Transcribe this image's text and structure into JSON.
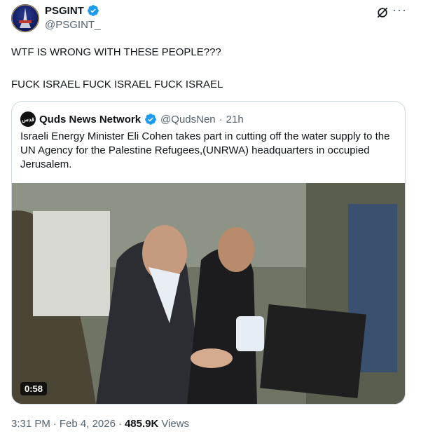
{
  "post": {
    "display_name": "PSGINT",
    "handle": "@PSGINT_",
    "avatar_text": "PSGINT",
    "line1": "WTF IS WRONG WITH THESE PEOPLE???",
    "line2": "FUCK ISRAEL FUCK ISRAEL FUCK ISRAEL",
    "time": "3:31 PM",
    "separator": "·",
    "date": "Feb 4, 2026",
    "views_count": "485.9K",
    "views_label": "Views"
  },
  "quote": {
    "display_name": "Quds News Network",
    "handle": "@QudsNen",
    "separator": "·",
    "time": "21h",
    "text": "Israeli Energy Minister Eli Cohen takes part in cutting off the water supply to the UN Agency for the Palestine Refugees,(UNRWA) headquarters in occupied Jerusalem.",
    "video_duration": "0:58"
  },
  "icons": {
    "verified": "verified-badge-icon",
    "grok": "grok-icon",
    "more": "more-options-icon"
  },
  "colors": {
    "verified_blue": "#1d9bf0",
    "secondary_text": "#536471",
    "border": "#cfd9de"
  }
}
